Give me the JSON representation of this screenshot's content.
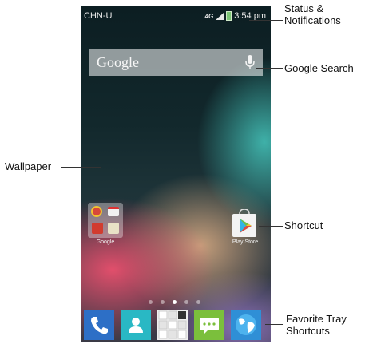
{
  "status_bar": {
    "carrier": "CHN-U",
    "network": "4G",
    "time": "3:54 pm"
  },
  "search": {
    "brand": "Google"
  },
  "home": {
    "folder_label": "Google",
    "shortcut_label": "Play Store",
    "page_count": 5,
    "active_page": 3
  },
  "tray": {
    "items": [
      {
        "name": "phone",
        "color": "#2d6fc6"
      },
      {
        "name": "contacts",
        "color": "#29b8c4"
      },
      {
        "name": "all-apps",
        "color": "#f0f0f0"
      },
      {
        "name": "messaging",
        "color": "#7bbf3c"
      },
      {
        "name": "browser",
        "color": "#2f8fd6"
      }
    ]
  },
  "annotations": {
    "status_line1": "Status &",
    "status_line2": "Notifications",
    "google_search": "Google Search",
    "wallpaper": "Wallpaper",
    "shortcut": "Shortcut",
    "tray_line1": "Favorite Tray",
    "tray_line2": "Shortcuts"
  }
}
